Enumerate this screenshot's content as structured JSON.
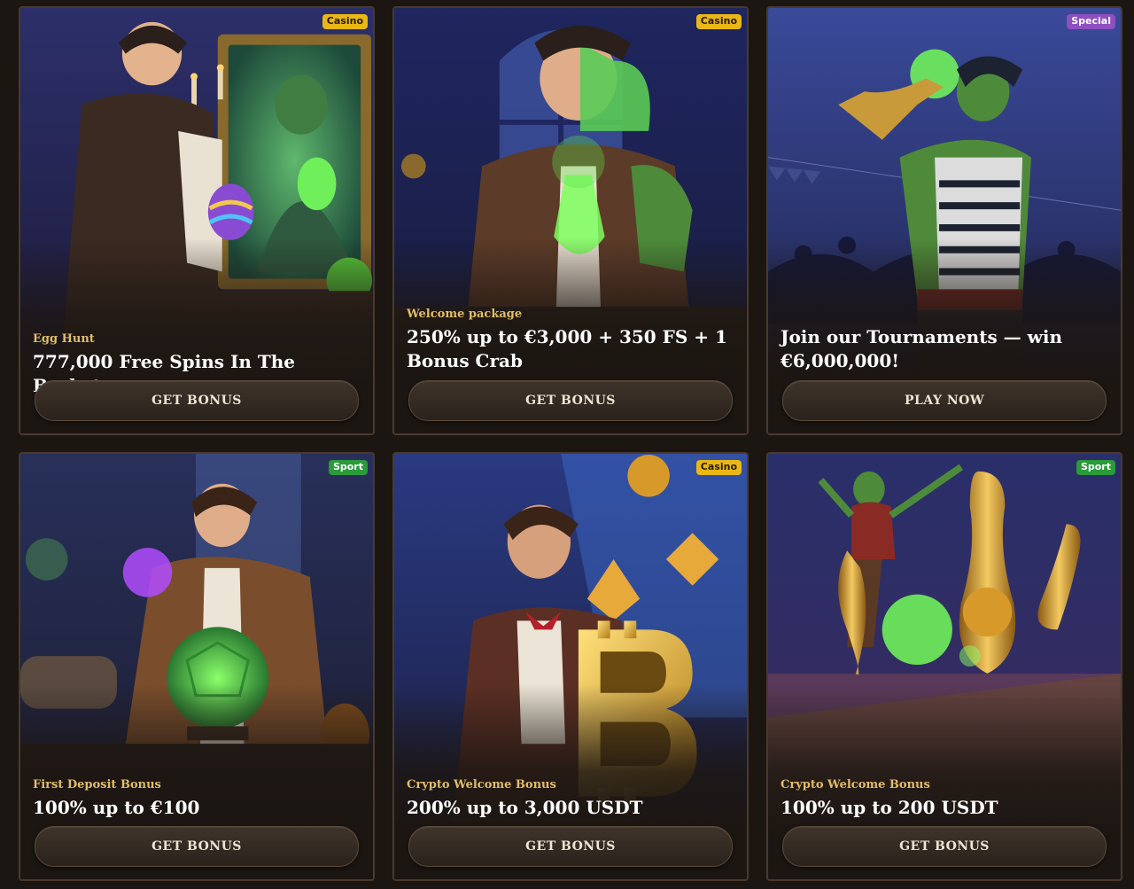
{
  "cards": [
    {
      "badge": "Casino",
      "badge_type": "casino",
      "subtitle": "Egg Hunt",
      "title": "777,000 Free Spins In The Basket",
      "button": "GET BONUS",
      "art": "magician-mirror-easter-egg"
    },
    {
      "badge": "Casino",
      "badge_type": "casino",
      "subtitle": "Welcome package",
      "title": "250% up to €3,000 + 350 FS + 1 Bonus Crab",
      "button": "GET BONUS",
      "art": "scientist-green-potion"
    },
    {
      "badge": "Special",
      "badge_type": "special",
      "subtitle": "",
      "title": "Join our Tournaments — win €6,000,000!",
      "button": "PLAY NOW",
      "art": "champion-trophy-crowd"
    },
    {
      "badge": "Sport",
      "badge_type": "sport",
      "subtitle": "First Deposit Bonus",
      "title": "100% up to €100",
      "button": "GET BONUS",
      "art": "alchemist-football-orb"
    },
    {
      "badge": "Casino",
      "badge_type": "casino",
      "subtitle": "Crypto Welcome Bonus",
      "title": "200% up to 3,000 USDT",
      "button": "GET BONUS",
      "art": "gentleman-bitcoin"
    },
    {
      "badge": "Sport",
      "badge_type": "sport",
      "subtitle": "Crypto Welcome Bonus",
      "title": "100% up to 200 USDT",
      "button": "GET BONUS",
      "art": "bowling-crypto-pins"
    }
  ],
  "colors": {
    "page_bg": "#1c1612",
    "card_border": "#4a3a2c",
    "subtitle": "#e1bd6a",
    "casino_badge": "#e9b716",
    "special_badge": "#8e4fbf",
    "sport_badge": "#2a9a3a"
  }
}
